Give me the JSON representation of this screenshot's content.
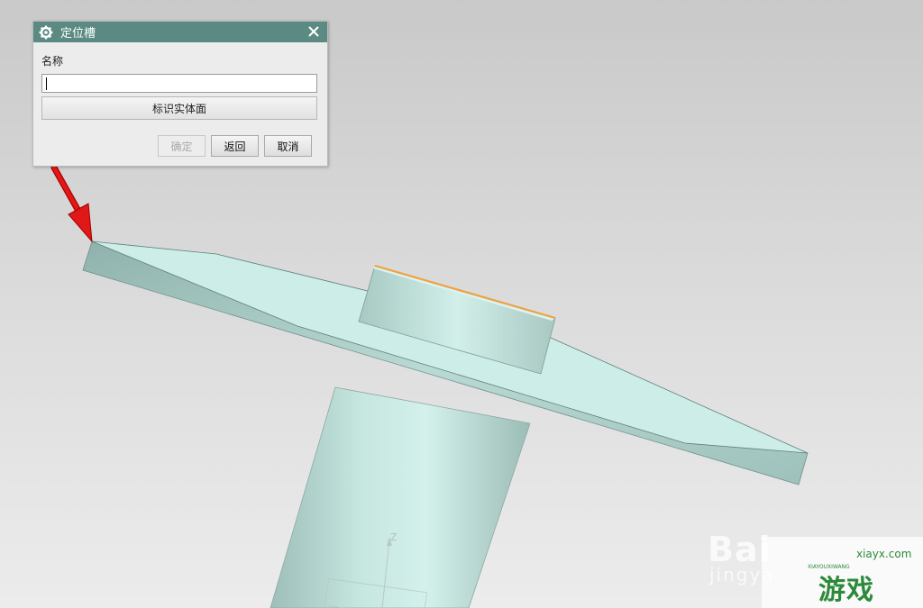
{
  "dialog": {
    "title": "定位槽",
    "name_label": "名称",
    "name_value": "",
    "select_face_button": "标识实体面",
    "ok_button": "确定",
    "back_button": "返回",
    "cancel_button": "取消"
  },
  "scene": {
    "axis_label": "Z"
  },
  "watermarks": {
    "baidu": "Bai",
    "jingyan": "jingya",
    "site_domain": "xiayx.com",
    "site_name": "游戏",
    "site_pinyin": "XIAYOUXIWANG"
  },
  "colors": {
    "title_bar": "#5a8a82",
    "model_face": "#cfeee8",
    "edge_highlight": "#f0a040",
    "arrow": "#e01010"
  }
}
